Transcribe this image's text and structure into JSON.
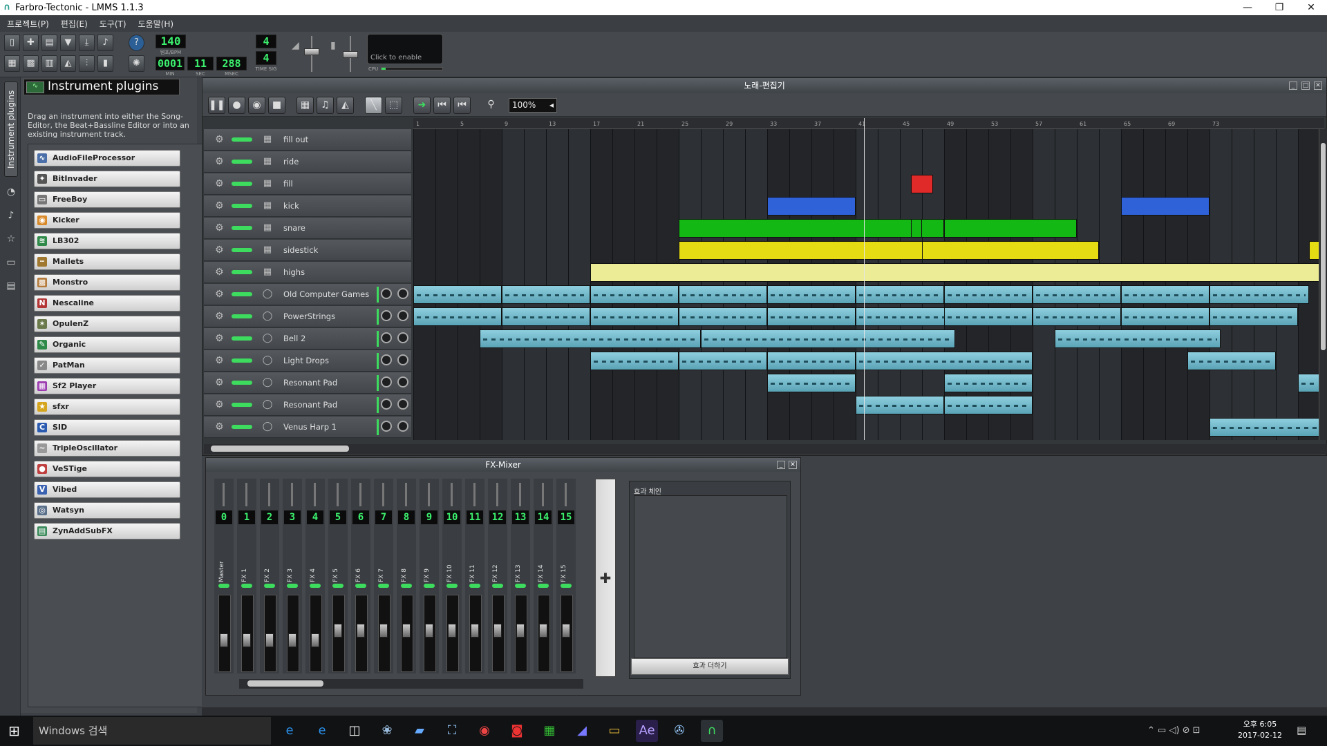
{
  "window": {
    "title": "Farbro-Tectonic - LMMS 1.1.3"
  },
  "menu": [
    "프로젝트(P)",
    "편집(E)",
    "도구(T)",
    "도움말(H)"
  ],
  "toolbar": {
    "tempo": "140",
    "tempo_label": "템포/BPM",
    "time_min": "0001",
    "time_sec": "11",
    "time_msec": "288",
    "min_label": "MIN",
    "sec_label": "SEC",
    "msec_label": "MSEC",
    "timesig_num": "4",
    "timesig_den": "4",
    "timesig_label": "TIME SIG",
    "cpu_hint": "Click to enable",
    "cpu_label": "CPU"
  },
  "sidebar": {
    "tab_label": "Instrument plugins"
  },
  "plugins_panel": {
    "title": "Instrument plugins",
    "description": "Drag an instrument into either the Song-Editor, the Beat+Bassline Editor or into an existing instrument track.",
    "items": [
      {
        "label": "AudioFileProcessor",
        "icon": "waveform-icon",
        "color": "#4b6fa8"
      },
      {
        "label": "BitInvader",
        "icon": "invader-icon",
        "color": "#555555"
      },
      {
        "label": "FreeBoy",
        "icon": "gameboy-icon",
        "color": "#777777"
      },
      {
        "label": "Kicker",
        "icon": "kick-icon",
        "color": "#d98a2b"
      },
      {
        "label": "LB302",
        "icon": "synth-icon",
        "color": "#2f8a4a"
      },
      {
        "label": "Mallets",
        "icon": "mallet-icon",
        "color": "#a0782f"
      },
      {
        "label": "Monstro",
        "icon": "monster-icon",
        "color": "#b47b3c"
      },
      {
        "label": "Nescaline",
        "icon": "nes-icon",
        "color": "#b33535"
      },
      {
        "label": "OpulenZ",
        "icon": "opl-icon",
        "color": "#6a7a4a"
      },
      {
        "label": "Organic",
        "icon": "organ-icon",
        "color": "#2f8a4a"
      },
      {
        "label": "PatMan",
        "icon": "patman-icon",
        "color": "#888888"
      },
      {
        "label": "Sf2 Player",
        "icon": "soundfont-icon",
        "color": "#9b3bb0"
      },
      {
        "label": "sfxr",
        "icon": "sfxr-icon",
        "color": "#d6a51e"
      },
      {
        "label": "SID",
        "icon": "sid-icon",
        "color": "#2a5bb0"
      },
      {
        "label": "TripleOscillator",
        "icon": "oscillator-icon",
        "color": "#999999"
      },
      {
        "label": "VeSTige",
        "icon": "vst-icon",
        "color": "#c04040"
      },
      {
        "label": "Vibed",
        "icon": "string-icon",
        "color": "#3a62b0"
      },
      {
        "label": "Watsyn",
        "icon": "watsyn-icon",
        "color": "#5a6f8a"
      },
      {
        "label": "ZynAddSubFX",
        "icon": "zyn-icon",
        "color": "#3a8a5a"
      }
    ]
  },
  "song_editor": {
    "title": "노래-편집기",
    "zoom": "100%",
    "ruler_marks": [
      "1",
      "5",
      "9",
      "13",
      "17",
      "21",
      "25",
      "29",
      "33",
      "37",
      "41",
      "45",
      "49",
      "53",
      "57",
      "61",
      "65",
      "69",
      "73"
    ],
    "tracks": [
      {
        "name": "fill out",
        "type": "bb"
      },
      {
        "name": "ride",
        "type": "bb"
      },
      {
        "name": "fill",
        "type": "bb"
      },
      {
        "name": "kick",
        "type": "bb"
      },
      {
        "name": "snare",
        "type": "bb"
      },
      {
        "name": "sidestick",
        "type": "bb"
      },
      {
        "name": "highs",
        "type": "bb"
      },
      {
        "name": "Old Computer Games",
        "type": "inst"
      },
      {
        "name": "PowerStrings",
        "type": "inst"
      },
      {
        "name": "Bell 2",
        "type": "inst"
      },
      {
        "name": "Light Drops",
        "type": "inst"
      },
      {
        "name": "Resonant Pad",
        "type": "inst"
      },
      {
        "name": "Resonant Pad",
        "type": "inst"
      },
      {
        "name": "Venus Harp 1",
        "type": "inst"
      }
    ],
    "colors": {
      "kick": "#2f62d8",
      "snare": "#14b814",
      "sidestick": "#e6dc14",
      "highs": "#ecec96",
      "fill": "#e02a2a",
      "instrument": "#7fc2d4"
    }
  },
  "fx_mixer": {
    "title": "FX-Mixer",
    "channels": [
      {
        "num": "0",
        "label": "Master"
      },
      {
        "num": "1",
        "label": "FX 1"
      },
      {
        "num": "2",
        "label": "FX 2"
      },
      {
        "num": "3",
        "label": "FX 3"
      },
      {
        "num": "4",
        "label": "FX 4"
      },
      {
        "num": "5",
        "label": "FX 5"
      },
      {
        "num": "6",
        "label": "FX 6"
      },
      {
        "num": "7",
        "label": "FX 7"
      },
      {
        "num": "8",
        "label": "FX 8"
      },
      {
        "num": "9",
        "label": "FX 9"
      },
      {
        "num": "10",
        "label": "FX 10"
      },
      {
        "num": "11",
        "label": "FX 11"
      },
      {
        "num": "12",
        "label": "FX 12"
      },
      {
        "num": "13",
        "label": "FX 13"
      },
      {
        "num": "14",
        "label": "FX 14"
      },
      {
        "num": "15",
        "label": "FX 15"
      }
    ],
    "chain_label": "효과 체인",
    "add_effect_label": "효과 더하기"
  },
  "taskbar": {
    "search_placeholder": "Windows 검색",
    "time": "오후 6:05",
    "date": "2017-02-12"
  }
}
